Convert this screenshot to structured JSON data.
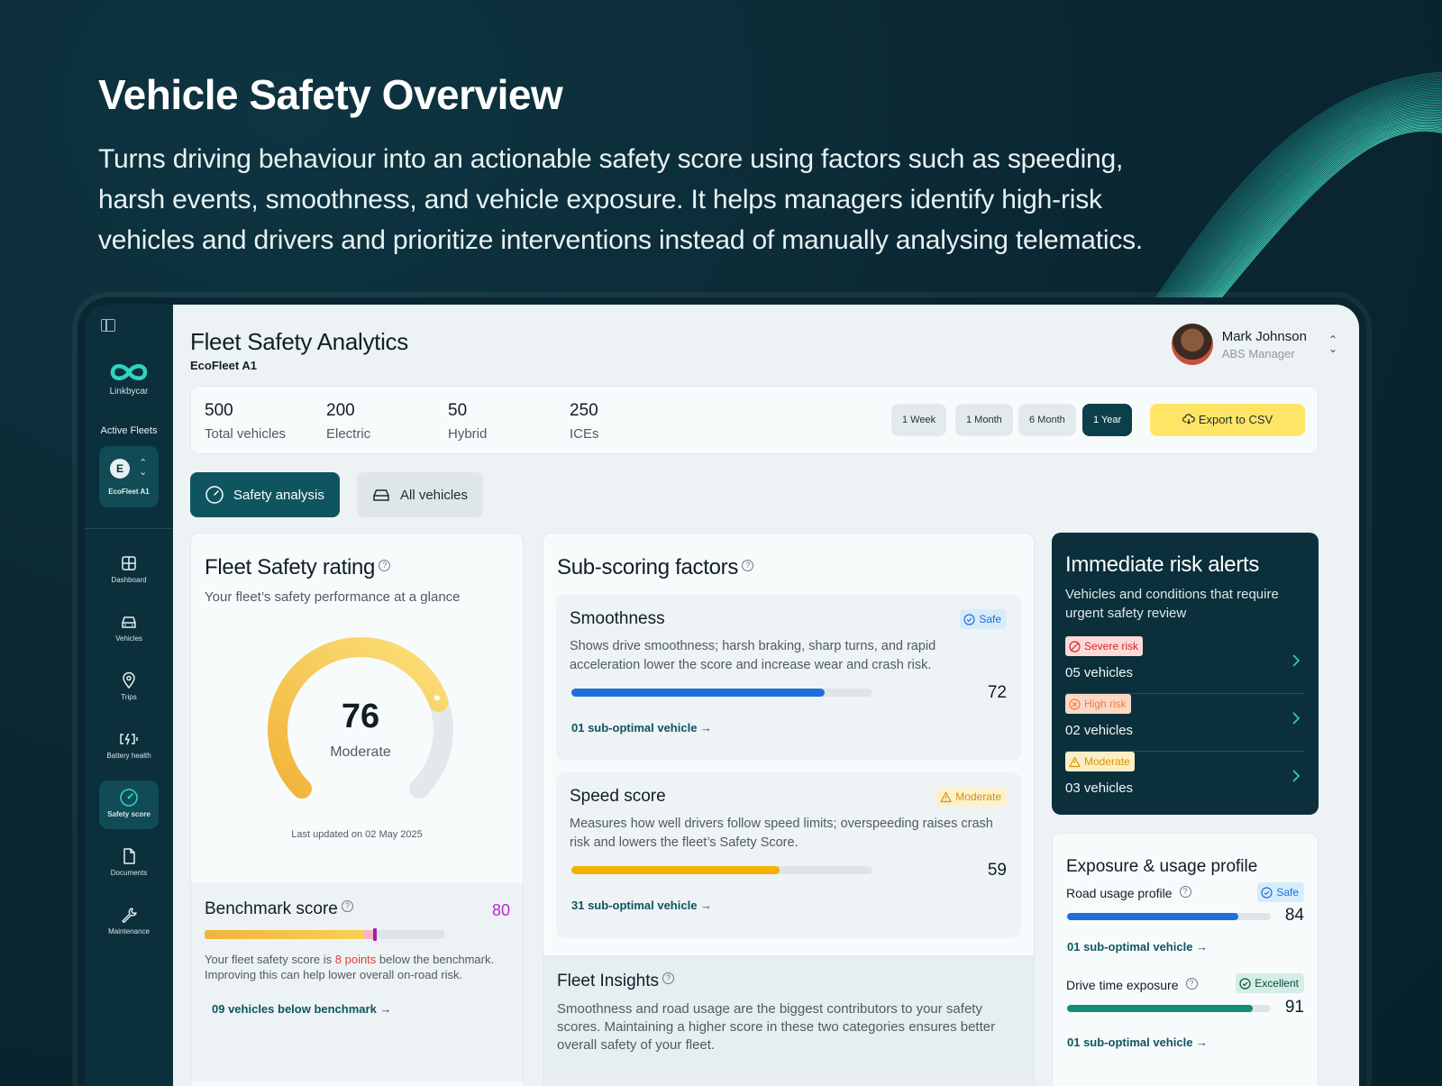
{
  "hero": {
    "title": "Vehicle Safety Overview",
    "description": "Turns driving behaviour into an actionable safety score using factors such as speeding, harsh events, smoothness, and vehicle exposure. It helps managers identify high-risk vehicles and drivers and prioritize interventions instead of manually analysing telematics."
  },
  "sidebar": {
    "brand": "Linkbycar",
    "active_fleets_label": "Active Fleets",
    "fleet_initial": "E",
    "fleet_name": "EcoFleet A1",
    "items": [
      {
        "label": "Dashboard",
        "icon": "dashboard-icon"
      },
      {
        "label": "Vehicles",
        "icon": "car-icon"
      },
      {
        "label": "Trips",
        "icon": "map-pin-icon"
      },
      {
        "label": "Battery health",
        "icon": "battery-charge-icon"
      },
      {
        "label": "Safety score",
        "icon": "gauge-icon",
        "active": true
      },
      {
        "label": "Documents",
        "icon": "document-icon"
      },
      {
        "label": "Maintenance",
        "icon": "wrench-icon"
      }
    ]
  },
  "header": {
    "title": "Fleet Safety Analytics",
    "subtitle": "EcoFleet A1",
    "user": {
      "name": "Mark Johnson",
      "role": "ABS Manager"
    }
  },
  "stats": [
    {
      "value": "500",
      "label": "Total vehicles"
    },
    {
      "value": "200",
      "label": "Electric"
    },
    {
      "value": "50",
      "label": "Hybrid"
    },
    {
      "value": "250",
      "label": "ICEs"
    }
  ],
  "ranges": [
    "1 Week",
    "1 Month",
    "6 Month",
    "1 Year"
  ],
  "active_range": "1 Year",
  "export_label": "Export to CSV",
  "tabs": [
    {
      "label": "Safety analysis",
      "active": true
    },
    {
      "label": "All vehicles",
      "active": false
    }
  ],
  "safety_rating": {
    "title": "Fleet Safety rating",
    "description": "Your fleet’s safety performance at a glance",
    "score": 76,
    "max": 100,
    "score_label": "Moderate",
    "last_updated": "Last updated on 02 May 2025"
  },
  "benchmark": {
    "title": "Benchmark score",
    "score": 80,
    "current": 76,
    "text_before": "Your fleet safety score is ",
    "text_highlight": "8 points",
    "text_after": " below the benchmark. Improving this can help lower overall on-road risk.",
    "link": "09 vehicles below benchmark →"
  },
  "subscoring": {
    "title": "Sub-scoring factors",
    "factors": [
      {
        "title": "Smoothness",
        "badge": "Safe",
        "description": "Shows drive smoothness; harsh braking, sharp turns, and rapid acceleration lower the score and increase wear and crash risk.",
        "score": 72,
        "link": "01 sub-optimal vehicle →",
        "color": "#1e6fd8"
      },
      {
        "title": "Speed score",
        "badge": "Moderate",
        "description": "Measures how well drivers follow speed limits; overspeeding raises crash risk and lowers the fleet’s Safety Score.",
        "score": 59,
        "link": "31 sub-optimal vehicle →",
        "color": "#f2b100"
      }
    ]
  },
  "insights": {
    "title": "Fleet Insights",
    "text": "Smoothness and road usage are the biggest contributors to your safety scores. Maintaining a higher score in these two categories ensures better overall safety of your fleet."
  },
  "alerts": {
    "title": "Immediate risk alerts",
    "description": "Vehicles and conditions that require urgent safety review",
    "items": [
      {
        "badge": "Severe risk",
        "count": "05 vehicles"
      },
      {
        "badge": "High risk",
        "count": "02 vehicles"
      },
      {
        "badge": "Moderate",
        "count": "03 vehicles"
      }
    ]
  },
  "exposure": {
    "title": "Exposure & usage profile",
    "rows": [
      {
        "label": "Road usage profile",
        "badge": "Safe",
        "score": 84,
        "link": "01 sub-optimal vehicle →",
        "color": "#1e6fd8"
      },
      {
        "label": "Drive time exposure",
        "badge": "Excellent",
        "score": 91,
        "link": "01 sub-optimal vehicle →",
        "color": "#0f8f7a"
      }
    ]
  },
  "colors": {
    "accent": "#0e5560",
    "dark": "#0b2f3b",
    "export": "#ffe566",
    "gauge": "#f8d055"
  }
}
